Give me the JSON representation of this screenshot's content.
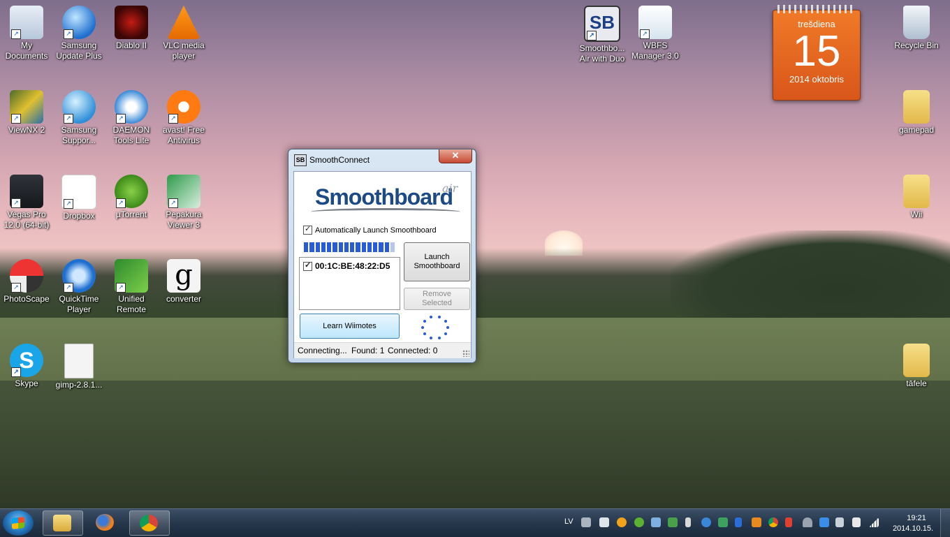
{
  "desktop_icons_left": [
    {
      "label": "My\nDocuments",
      "icon": "documents-icon",
      "name": "my-documents"
    },
    {
      "label": "Samsung\nUpdate Plus",
      "icon": "globe-update-icon",
      "name": "samsung-update-plus"
    },
    {
      "label": "Diablo II",
      "icon": "diablo-icon",
      "name": "diablo-ii"
    },
    {
      "label": "VLC media\nplayer",
      "icon": "vlc-cone-icon",
      "name": "vlc-media-player"
    },
    {
      "label": "ViewNX 2",
      "icon": "viewnx-icon",
      "name": "viewnx-2"
    },
    {
      "label": "Samsung\nSuppor...",
      "icon": "samsung-support-icon",
      "name": "samsung-support"
    },
    {
      "label": "DAEMON\nTools Lite",
      "icon": "daemon-tools-icon",
      "name": "daemon-tools-lite"
    },
    {
      "label": "avast! Free\nAntivirus",
      "icon": "avast-icon",
      "name": "avast-free-antivirus"
    },
    {
      "label": "Vegas Pro\n12.0 (64-bit)",
      "icon": "vegas-play-icon",
      "name": "vegas-pro"
    },
    {
      "label": "Dropbox",
      "icon": "dropbox-icon",
      "name": "dropbox"
    },
    {
      "label": "µTorrent",
      "icon": "utorrent-icon",
      "name": "utorrent"
    },
    {
      "label": "Pepakura\nViewer 3",
      "icon": "pepakura-icon",
      "name": "pepakura-viewer"
    },
    {
      "label": "PhotoScape",
      "icon": "photoscape-icon",
      "name": "photoscape"
    },
    {
      "label": "QuickTime\nPlayer",
      "icon": "quicktime-icon",
      "name": "quicktime-player"
    },
    {
      "label": "Unified\nRemote",
      "icon": "unified-remote-icon",
      "name": "unified-remote"
    },
    {
      "label": "converter",
      "icon": "converter-icon",
      "name": "converter"
    },
    {
      "label": "Skype",
      "icon": "skype-icon",
      "name": "skype"
    },
    {
      "label": "gimp-2.8.1...",
      "icon": "torrent-file-icon",
      "name": "gimp-torrent"
    }
  ],
  "desktop_icons_top": [
    {
      "label": "Smoothbo...\nAir with Duo",
      "icon": "smoothboard-icon",
      "name": "smoothboard-air"
    },
    {
      "label": "WBFS\nManager 3.0",
      "icon": "wbfs-icon",
      "name": "wbfs-manager"
    }
  ],
  "desktop_icons_right": [
    {
      "label": "Recycle Bin",
      "icon": "recycle-bin-icon",
      "name": "recycle-bin"
    },
    {
      "label": "gamepad",
      "icon": "folder-icon",
      "name": "folder-gamepad"
    },
    {
      "label": "Wii",
      "icon": "folder-icon",
      "name": "folder-wii"
    },
    {
      "label": "tāfele",
      "icon": "folder-icon",
      "name": "folder-tafele"
    }
  ],
  "calendar": {
    "weekday": "trešdiena",
    "day": "15",
    "month_year": "2014 oktobris"
  },
  "window": {
    "title": "SmoothConnect",
    "title_icon": "SB",
    "close_glyph": "✕",
    "logo_text": "Smoothboard",
    "logo_suffix": "air",
    "auto_launch_label": "Automatically Launch Smoothboard",
    "progress": {
      "filled": 15,
      "total": 16
    },
    "device": "00:1C:BE:48:22:D5",
    "launch_button": "Launch\nSmoothboard",
    "remove_button": "Remove\nSelected",
    "learn_button": "Learn Wiimotes",
    "status": {
      "state": "Connecting...",
      "found": "Found: 1",
      "connected": "Connected: 0"
    }
  },
  "taskbar": {
    "language": "LV",
    "time": "19:21",
    "date": "2014.10.15.",
    "pinned": [
      "explorer-icon",
      "firefox-icon",
      "chrome-icon"
    ]
  },
  "colors": {
    "accent": "#2a5bd7",
    "calendar": "#e8631f",
    "taskbar": "#26374c"
  }
}
